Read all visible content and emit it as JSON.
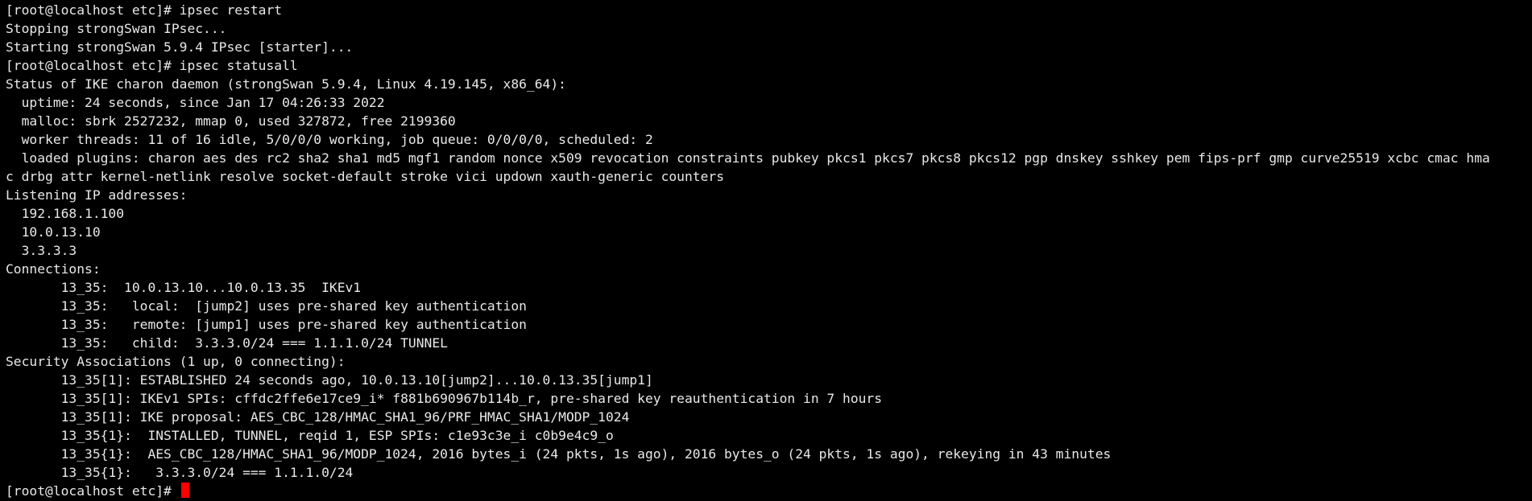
{
  "terminal": {
    "lines": [
      "[root@localhost etc]# ipsec restart",
      "Stopping strongSwan IPsec...",
      "Starting strongSwan 5.9.4 IPsec [starter]...",
      "[root@localhost etc]# ipsec statusall",
      "Status of IKE charon daemon (strongSwan 5.9.4, Linux 4.19.145, x86_64):",
      "  uptime: 24 seconds, since Jan 17 04:26:33 2022",
      "  malloc: sbrk 2527232, mmap 0, used 327872, free 2199360",
      "  worker threads: 11 of 16 idle, 5/0/0/0 working, job queue: 0/0/0/0, scheduled: 2",
      "  loaded plugins: charon aes des rc2 sha2 sha1 md5 mgf1 random nonce x509 revocation constraints pubkey pkcs1 pkcs7 pkcs8 pkcs12 pgp dnskey sshkey pem fips-prf gmp curve25519 xcbc cmac hma",
      "c drbg attr kernel-netlink resolve socket-default stroke vici updown xauth-generic counters",
      "Listening IP addresses:",
      "  192.168.1.100",
      "  10.0.13.10",
      "  3.3.3.3",
      "Connections:",
      "       13_35:  10.0.13.10...10.0.13.35  IKEv1",
      "       13_35:   local:  [jump2] uses pre-shared key authentication",
      "       13_35:   remote: [jump1] uses pre-shared key authentication",
      "       13_35:   child:  3.3.3.0/24 === 1.1.1.0/24 TUNNEL",
      "Security Associations (1 up, 0 connecting):",
      "       13_35[1]: ESTABLISHED 24 seconds ago, 10.0.13.10[jump2]...10.0.13.35[jump1]",
      "       13_35[1]: IKEv1 SPIs: cffdc2ffe6e17ce9_i* f881b690967b114b_r, pre-shared key reauthentication in 7 hours",
      "       13_35[1]: IKE proposal: AES_CBC_128/HMAC_SHA1_96/PRF_HMAC_SHA1/MODP_1024",
      "       13_35{1}:  INSTALLED, TUNNEL, reqid 1, ESP SPIs: c1e93c3e_i c0b9e4c9_o",
      "       13_35{1}:  AES_CBC_128/HMAC_SHA1_96/MODP_1024, 2016 bytes_i (24 pkts, 1s ago), 2016 bytes_o (24 pkts, 1s ago), rekeying in 43 minutes",
      "       13_35{1}:   3.3.3.0/24 === 1.1.1.0/24"
    ],
    "prompt": "[root@localhost etc]# ",
    "cursor_color": "#ff0000",
    "text_color": "#e8e8e8",
    "background_color": "#000000"
  }
}
